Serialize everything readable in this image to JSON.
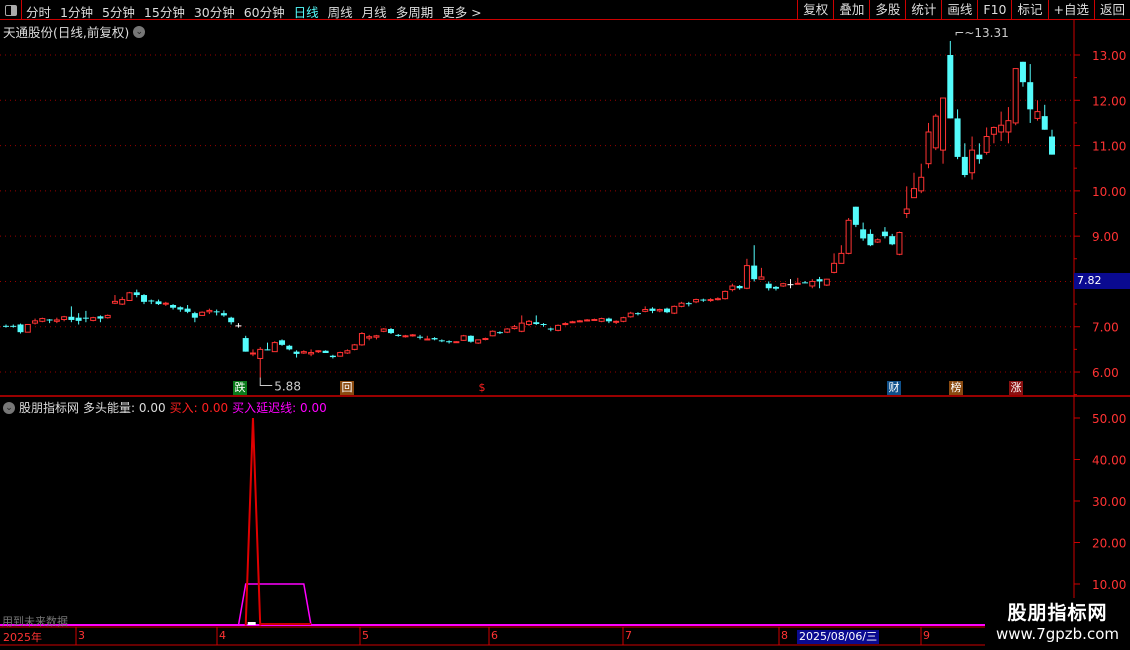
{
  "toolbar": {
    "periods": [
      "分时",
      "1分钟",
      "5分钟",
      "15分钟",
      "30分钟",
      "60分钟",
      "日线",
      "周线",
      "月线",
      "多周期",
      "更多 >"
    ],
    "active_period": "日线",
    "buttons": [
      "复权",
      "叠加",
      "多股",
      "统计",
      "画线",
      "F10",
      "标记",
      "+自选",
      "返回"
    ]
  },
  "stock_title": "天通股份(日线,前复权)",
  "price_axis": {
    "labels": [
      "13.00",
      "12.00",
      "11.00",
      "10.00",
      "9.00",
      "8.00",
      "7.00",
      "6.00"
    ],
    "values": [
      13,
      12,
      11,
      10,
      9,
      8,
      7,
      6
    ],
    "current_price_tag": "7.82",
    "range": [
      5.6,
      13.7
    ]
  },
  "annotations": {
    "high": "13.31",
    "low": "5.88"
  },
  "colors": {
    "up": "#ff3333",
    "down": "#54fcfc",
    "doji": "#ffffff",
    "magenta": "#ff00ff",
    "grid": "#990000",
    "selected_date_bg": "#0a0a90"
  },
  "markers": [
    {
      "text": "跌",
      "bg": "#0a7a1a"
    },
    {
      "text": "回",
      "bg": "#8a4a10"
    },
    {
      "text": "$",
      "bg": "transparent"
    },
    {
      "text": "财",
      "bg": "#10508a"
    },
    {
      "text": "榜",
      "bg": "#8a4a10"
    },
    {
      "text": "涨",
      "bg": "#8a1010"
    }
  ],
  "candles": [
    [
      7.02,
      7.0,
      7.05,
      6.98
    ],
    [
      7.02,
      7.0,
      7.05,
      6.98
    ],
    [
      7.05,
      6.88,
      7.07,
      6.85
    ],
    [
      6.88,
      7.05,
      7.06,
      6.88
    ],
    [
      7.08,
      7.13,
      7.18,
      7.05
    ],
    [
      7.12,
      7.18,
      7.2,
      7.1
    ],
    [
      7.16,
      7.14,
      7.17,
      7.08
    ],
    [
      7.12,
      7.15,
      7.2,
      7.08
    ],
    [
      7.16,
      7.22,
      7.24,
      7.12
    ],
    [
      7.22,
      7.15,
      7.45,
      7.1
    ],
    [
      7.2,
      7.13,
      7.3,
      7.05
    ],
    [
      7.2,
      7.19,
      7.35,
      7.1
    ],
    [
      7.14,
      7.2,
      7.22,
      7.12
    ],
    [
      7.23,
      7.18,
      7.25,
      7.1
    ],
    [
      7.2,
      7.25,
      7.27,
      7.18
    ],
    [
      7.52,
      7.56,
      7.7,
      7.5
    ],
    [
      7.5,
      7.6,
      7.66,
      7.48
    ],
    [
      7.58,
      7.75,
      7.77,
      7.58
    ],
    [
      7.76,
      7.7,
      7.82,
      7.65
    ],
    [
      7.7,
      7.55,
      7.72,
      7.5
    ],
    [
      7.58,
      7.56,
      7.6,
      7.5
    ],
    [
      7.56,
      7.5,
      7.6,
      7.48
    ],
    [
      7.5,
      7.52,
      7.55,
      7.46
    ],
    [
      7.48,
      7.42,
      7.5,
      7.38
    ],
    [
      7.43,
      7.38,
      7.45,
      7.33
    ],
    [
      7.4,
      7.33,
      7.48,
      7.3
    ],
    [
      7.3,
      7.2,
      7.33,
      7.1
    ],
    [
      7.25,
      7.32,
      7.34,
      7.24
    ],
    [
      7.33,
      7.36,
      7.4,
      7.28
    ],
    [
      7.34,
      7.33,
      7.38,
      7.25
    ],
    [
      7.3,
      7.25,
      7.36,
      7.22
    ],
    [
      7.2,
      7.1,
      7.22,
      7.05
    ],
    [
      7.03,
      7.03,
      7.08,
      6.98
    ],
    [
      6.75,
      6.45,
      6.8,
      6.45
    ],
    [
      6.4,
      6.42,
      6.5,
      6.35
    ],
    [
      6.3,
      6.5,
      6.55,
      5.88
    ],
    [
      6.5,
      6.48,
      6.65,
      6.48
    ],
    [
      6.45,
      6.65,
      6.68,
      6.45
    ],
    [
      6.7,
      6.6,
      6.72,
      6.58
    ],
    [
      6.58,
      6.5,
      6.6,
      6.48
    ],
    [
      6.45,
      6.4,
      6.48,
      6.32
    ],
    [
      6.42,
      6.45,
      6.48,
      6.4
    ],
    [
      6.4,
      6.43,
      6.5,
      6.35
    ],
    [
      6.45,
      6.47,
      6.48,
      6.42
    ],
    [
      6.47,
      6.42,
      6.48,
      6.42
    ],
    [
      6.36,
      6.33,
      6.38,
      6.3
    ],
    [
      6.35,
      6.43,
      6.45,
      6.34
    ],
    [
      6.42,
      6.47,
      6.5,
      6.4
    ],
    [
      6.5,
      6.6,
      6.62,
      6.48
    ],
    [
      6.6,
      6.85,
      6.88,
      6.58
    ],
    [
      6.75,
      6.78,
      6.82,
      6.7
    ],
    [
      6.77,
      6.8,
      6.82,
      6.72
    ],
    [
      6.9,
      6.95,
      6.97,
      6.88
    ],
    [
      6.95,
      6.86,
      6.97,
      6.84
    ],
    [
      6.82,
      6.8,
      6.84,
      6.78
    ],
    [
      6.78,
      6.8,
      6.82,
      6.76
    ],
    [
      6.8,
      6.82,
      6.84,
      6.78
    ],
    [
      6.78,
      6.76,
      6.82,
      6.72
    ],
    [
      6.72,
      6.73,
      6.8,
      6.7
    ],
    [
      6.75,
      6.72,
      6.77,
      6.7
    ],
    [
      6.7,
      6.69,
      6.72,
      6.66
    ],
    [
      6.68,
      6.66,
      6.7,
      6.63
    ],
    [
      6.66,
      6.67,
      6.68,
      6.64
    ],
    [
      6.7,
      6.8,
      6.82,
      6.69
    ],
    [
      6.8,
      6.67,
      6.81,
      6.65
    ],
    [
      6.64,
      6.71,
      6.72,
      6.62
    ],
    [
      6.72,
      6.74,
      6.76,
      6.7
    ],
    [
      6.8,
      6.9,
      6.92,
      6.79
    ],
    [
      6.88,
      6.87,
      6.9,
      6.84
    ],
    [
      6.88,
      6.95,
      6.97,
      6.86
    ],
    [
      6.96,
      7.0,
      7.04,
      6.94
    ],
    [
      6.9,
      7.08,
      7.25,
      6.88
    ],
    [
      7.05,
      7.12,
      7.15,
      7.02
    ],
    [
      7.1,
      7.06,
      7.25,
      7.04
    ],
    [
      7.06,
      7.04,
      7.08,
      7.0
    ],
    [
      6.96,
      6.94,
      6.98,
      6.9
    ],
    [
      6.92,
      7.03,
      7.05,
      6.9
    ],
    [
      7.05,
      7.07,
      7.1,
      7.03
    ],
    [
      7.1,
      7.11,
      7.13,
      7.08
    ],
    [
      7.12,
      7.13,
      7.15,
      7.1
    ],
    [
      7.14,
      7.15,
      7.17,
      7.12
    ],
    [
      7.15,
      7.16,
      7.18,
      7.13
    ],
    [
      7.12,
      7.18,
      7.2,
      7.1
    ],
    [
      7.18,
      7.12,
      7.2,
      7.08
    ],
    [
      7.1,
      7.12,
      7.14,
      7.06
    ],
    [
      7.12,
      7.2,
      7.22,
      7.1
    ],
    [
      7.22,
      7.3,
      7.33,
      7.2
    ],
    [
      7.3,
      7.28,
      7.32,
      7.25
    ],
    [
      7.34,
      7.38,
      7.45,
      7.32
    ],
    [
      7.4,
      7.35,
      7.43,
      7.3
    ],
    [
      7.35,
      7.38,
      7.4,
      7.32
    ],
    [
      7.4,
      7.32,
      7.42,
      7.3
    ],
    [
      7.3,
      7.45,
      7.47,
      7.28
    ],
    [
      7.45,
      7.52,
      7.55,
      7.43
    ],
    [
      7.52,
      7.5,
      7.55,
      7.45
    ],
    [
      7.55,
      7.6,
      7.62,
      7.52
    ],
    [
      7.6,
      7.58,
      7.62,
      7.55
    ],
    [
      7.58,
      7.6,
      7.63,
      7.55
    ],
    [
      7.6,
      7.62,
      7.65,
      7.58
    ],
    [
      7.62,
      7.78,
      7.8,
      7.6
    ],
    [
      7.82,
      7.9,
      7.95,
      7.78
    ],
    [
      7.9,
      7.85,
      7.92,
      7.82
    ],
    [
      7.85,
      8.35,
      8.5,
      7.83
    ],
    [
      8.35,
      8.05,
      8.8,
      8.0
    ],
    [
      8.05,
      8.1,
      8.3,
      8.05
    ],
    [
      7.95,
      7.85,
      8.0,
      7.8
    ],
    [
      7.88,
      7.84,
      7.9,
      7.8
    ],
    [
      7.9,
      7.95,
      7.97,
      7.88
    ],
    [
      7.94,
      7.94,
      8.05,
      7.85
    ],
    [
      7.95,
      7.96,
      8.08,
      7.94
    ],
    [
      7.98,
      7.97,
      8.01,
      7.96
    ],
    [
      7.9,
      8.0,
      8.05,
      7.85
    ],
    [
      8.05,
      8.0,
      8.1,
      7.85
    ],
    [
      7.92,
      8.05,
      8.06,
      7.9
    ],
    [
      8.2,
      8.4,
      8.62,
      8.18
    ],
    [
      8.4,
      8.62,
      8.8,
      8.4
    ],
    [
      8.62,
      9.35,
      9.4,
      8.6
    ],
    [
      9.65,
      9.25,
      9.65,
      9.2
    ],
    [
      9.15,
      8.95,
      9.3,
      8.9
    ],
    [
      9.05,
      8.8,
      9.15,
      8.78
    ],
    [
      8.87,
      8.92,
      8.95,
      8.85
    ],
    [
      9.1,
      9.0,
      9.2,
      8.95
    ],
    [
      9.0,
      8.82,
      9.05,
      8.8
    ],
    [
      8.6,
      9.08,
      9.1,
      8.58
    ],
    [
      9.5,
      9.6,
      10.1,
      9.4
    ],
    [
      9.85,
      10.05,
      10.4,
      9.9
    ],
    [
      10.0,
      10.3,
      10.6,
      9.95
    ],
    [
      10.6,
      11.3,
      11.5,
      10.5
    ],
    [
      10.95,
      11.65,
      11.7,
      10.9
    ],
    [
      10.9,
      12.05,
      12.05,
      10.6
    ],
    [
      13.0,
      11.6,
      13.31,
      11.6
    ],
    [
      11.6,
      10.75,
      11.8,
      10.7
    ],
    [
      10.75,
      10.35,
      11.05,
      10.3
    ],
    [
      10.4,
      10.9,
      11.2,
      10.25
    ],
    [
      10.8,
      10.7,
      11.05,
      10.6
    ],
    [
      10.85,
      11.2,
      11.4,
      10.8
    ],
    [
      11.25,
      11.4,
      11.42,
      11.05
    ],
    [
      11.3,
      11.45,
      11.75,
      11.1
    ],
    [
      11.3,
      11.55,
      11.85,
      11.05
    ],
    [
      11.5,
      12.7,
      12.7,
      11.45
    ],
    [
      12.85,
      12.4,
      12.85,
      12.3
    ],
    [
      12.4,
      11.8,
      12.8,
      11.5
    ],
    [
      11.6,
      11.75,
      12.0,
      11.55
    ],
    [
      11.65,
      11.35,
      11.9,
      11.35
    ],
    [
      11.2,
      10.8,
      11.35,
      10.8
    ]
  ],
  "indicator": {
    "name": "股朋指标网",
    "fields": [
      {
        "label": "多头能量: 0.00",
        "color": "#dddddd"
      },
      {
        "label": "买入: 0.00",
        "color": "#ff2020"
      },
      {
        "label": "买入延迟线: 0.00",
        "color": "#ff00ff"
      }
    ],
    "axis_labels": [
      "50.00",
      "40.00",
      "30.00",
      "20.00",
      "10.00"
    ],
    "axis_values": [
      50,
      40,
      30,
      20,
      10
    ],
    "range": [
      0,
      53
    ],
    "buy_points": [
      [
        33,
        0
      ],
      [
        34,
        50
      ],
      [
        35,
        0
      ]
    ],
    "delay_points": [
      [
        32,
        0
      ],
      [
        33,
        10
      ],
      [
        41,
        10
      ],
      [
        42,
        0
      ]
    ],
    "future_note": "用到未来数据"
  },
  "time_axis": {
    "labels": [
      "2025年",
      "3",
      "4",
      "5",
      "6",
      "7",
      "8",
      "9"
    ],
    "selected_date": "2025/08/06/三"
  },
  "watermark": {
    "title": "股朋指标网",
    "url": "www.7gpzb.com"
  }
}
